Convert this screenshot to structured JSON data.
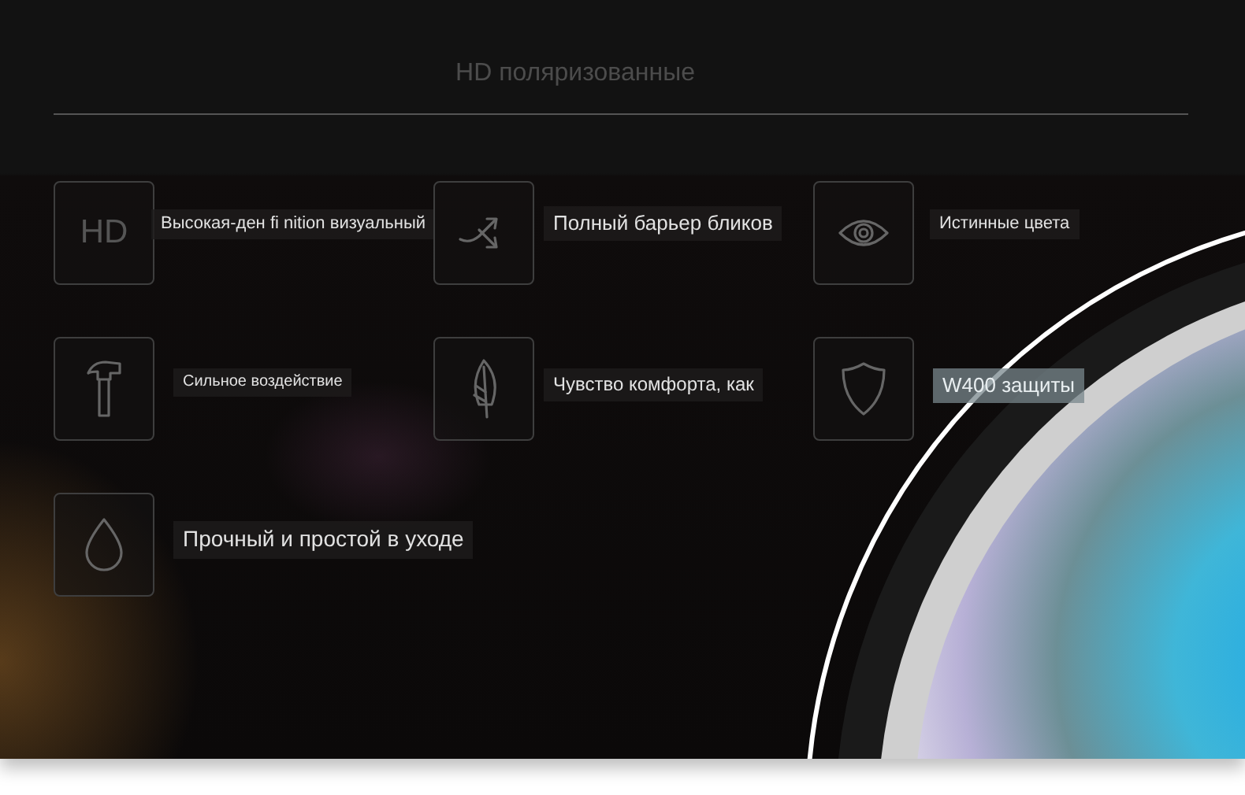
{
  "title": "HD поляризованные",
  "features": [
    {
      "kind": "text",
      "icon_text": "HD",
      "label": "Высокая-ден fi nition визуальный"
    },
    {
      "kind": "shuffle",
      "label": "Полный барьер бликов"
    },
    {
      "kind": "eye",
      "label": "Истинные цвета"
    },
    {
      "kind": "hammer",
      "label": "Сильное воздействие"
    },
    {
      "kind": "feather",
      "label": "Чувство комфорта, как"
    },
    {
      "kind": "shield",
      "label": "W400 защиты"
    },
    {
      "kind": "drop",
      "label": "Прочный и простой в уходе"
    }
  ]
}
